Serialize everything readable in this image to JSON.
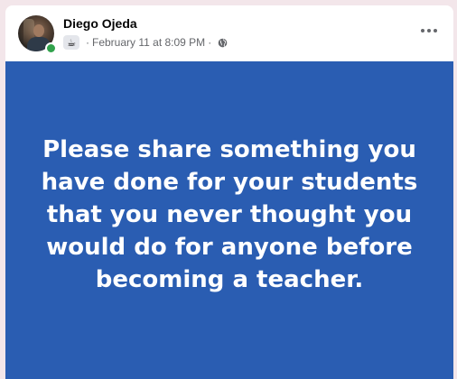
{
  "post": {
    "author": "Diego Ojeda",
    "activity_icon": "coffee-icon",
    "timestamp": "February 11 at 8:09 PM",
    "separator": "·",
    "privacy_icon": "globe-icon",
    "more_icon": "more-options-icon",
    "background_color": "#2a5db2",
    "text_color": "#ffffff",
    "body_text": "Please share something you have done for your students that you never thought you would do for anyone before becoming a teacher."
  }
}
